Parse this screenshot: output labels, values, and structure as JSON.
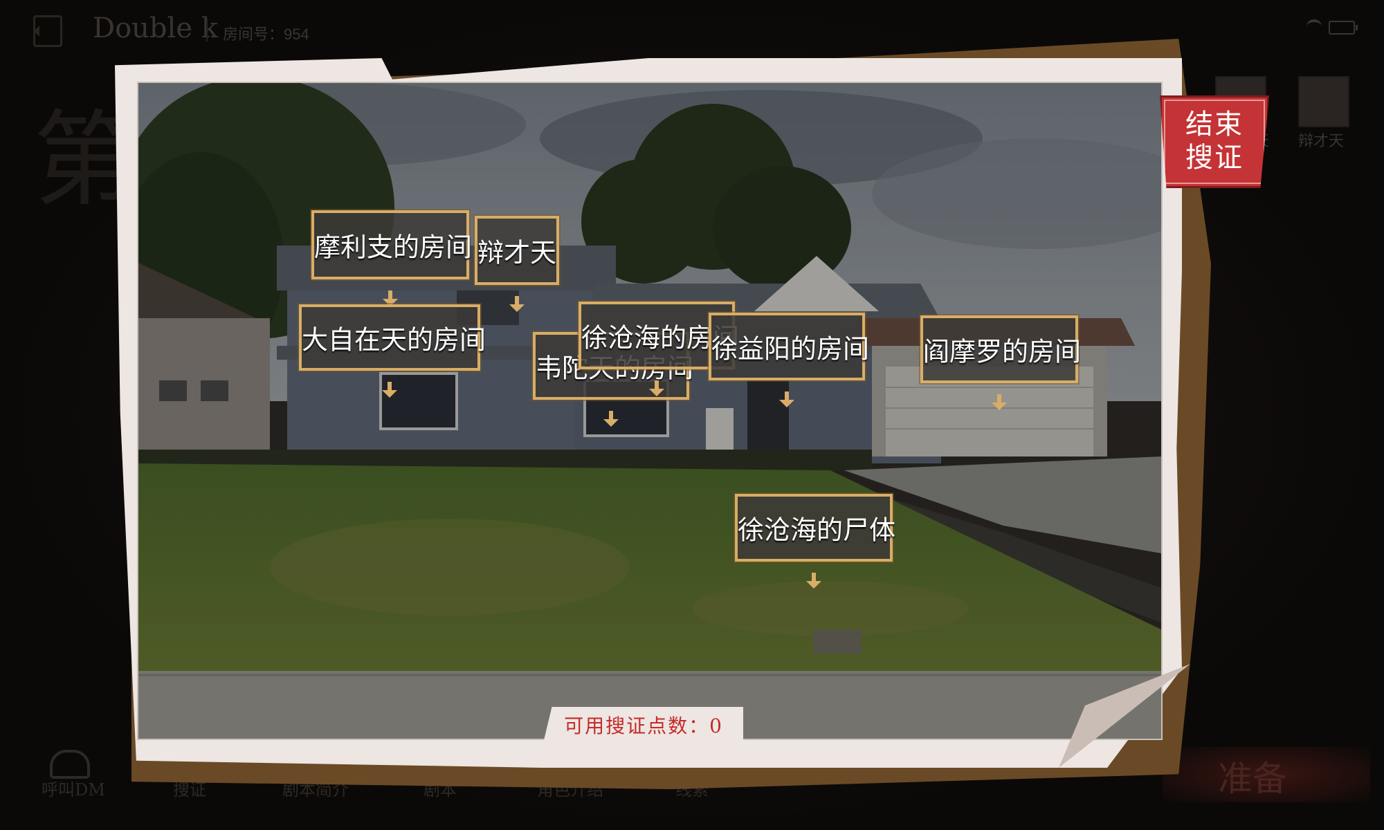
{
  "header": {
    "room_name": "Double k",
    "room_number": "房间号：954"
  },
  "background": {
    "big_char": "第",
    "players": [
      {
        "name": "天"
      },
      {
        "name": "辩才天"
      }
    ]
  },
  "bottom_nav": {
    "call_dm": "呼叫DM",
    "search": "搜证",
    "script_intro": "剧本简介",
    "script": "剧本",
    "character_intro": "角色介绍",
    "clues": "线索",
    "ready": "准备"
  },
  "board": {
    "end_search_label": "结束\n搜证",
    "search_points": "可用搜证点数：0",
    "locations": [
      {
        "label": "摩利支的房间"
      },
      {
        "label": "辩才天"
      },
      {
        "label": "大自在天的房间"
      },
      {
        "label": "韦陀天的房间"
      },
      {
        "label": "徐沧海的房间"
      },
      {
        "label": "徐益阳的房间"
      },
      {
        "label": "阎摩罗的房间"
      },
      {
        "label": "徐沧海的尸体"
      }
    ]
  },
  "colors": {
    "accent_red": "#c43335",
    "tag_gold": "#d9ad67",
    "board_brown": "#6a4a26",
    "paper": "#ede6e2"
  }
}
